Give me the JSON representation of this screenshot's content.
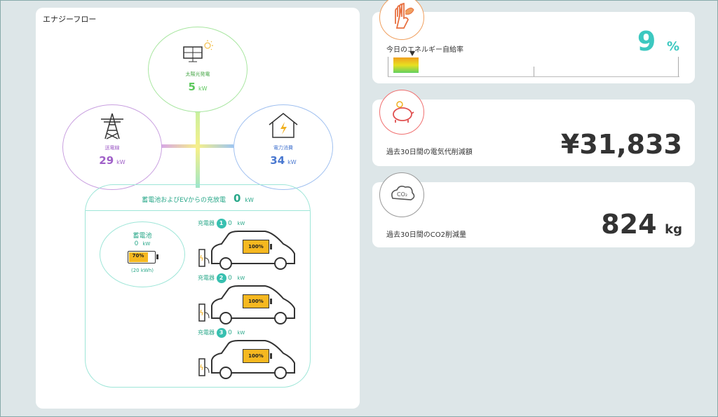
{
  "flow": {
    "title": "エナジーフロー",
    "solar": {
      "label": "太陽光発電",
      "value": "5",
      "unit": "kW"
    },
    "grid": {
      "label": "送電線",
      "value": "29",
      "unit": "kW"
    },
    "consumption": {
      "label": "電力消費",
      "value": "34",
      "unit": "kW"
    },
    "storage": {
      "title": "蓄電池およびEVからの充放電",
      "value": "0",
      "unit": "kW",
      "battery": {
        "label": "蓄電池",
        "value": "0",
        "unit": "kW",
        "level": "70%",
        "capacity": "(20 kWh)"
      },
      "chargers": [
        {
          "label": "充電器",
          "num": "1",
          "value": "0",
          "unit": "kW",
          "level": "100%"
        },
        {
          "label": "充電器",
          "num": "2",
          "value": "0",
          "unit": "kW",
          "level": "100%"
        },
        {
          "label": "充電器",
          "num": "3",
          "value": "0",
          "unit": "kW",
          "level": "100%"
        }
      ]
    }
  },
  "self_sufficiency": {
    "label": "今日のエネルギー自給率",
    "value": "9",
    "unit": "%",
    "icon": "leaf-hand-icon",
    "color": "#3cc8c0"
  },
  "savings": {
    "label": "過去30日間の電気代削減額",
    "value": "¥31,833",
    "icon": "piggy-bank-icon"
  },
  "co2": {
    "label": "過去30日間のCO2削減量",
    "value": "824",
    "unit": "kg",
    "icon": "co2-cloud-icon"
  }
}
